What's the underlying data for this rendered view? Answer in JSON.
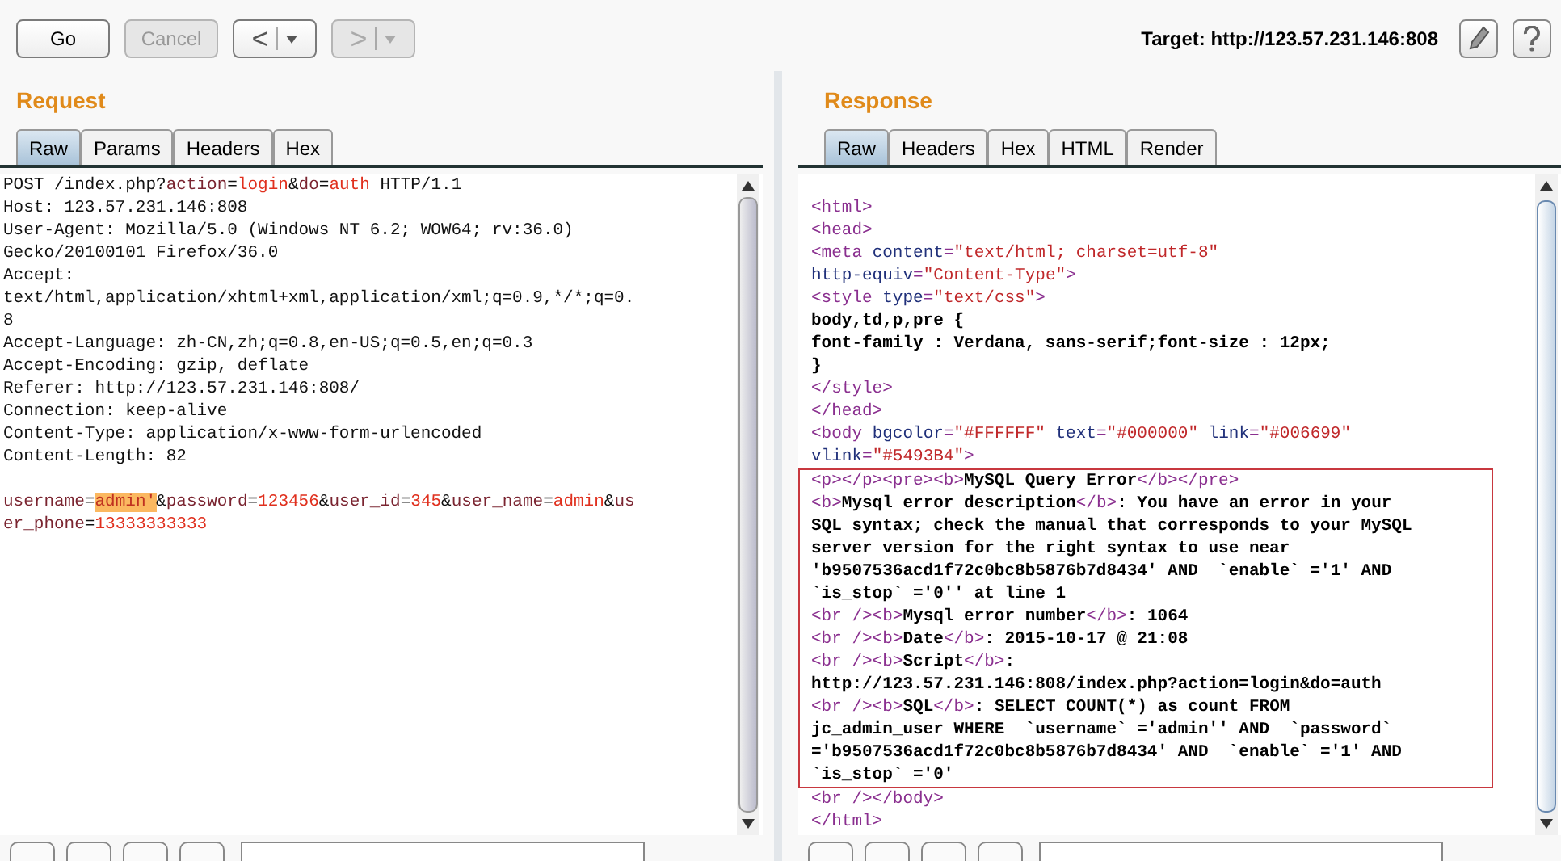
{
  "toolbar": {
    "buttons": [
      {
        "label": "Go",
        "disabled": false
      },
      {
        "label": "Cancel",
        "disabled": true
      }
    ],
    "history": [
      {
        "glyph": "<",
        "disabled": false
      },
      {
        "glyph": ">",
        "disabled": true
      }
    ],
    "target": "Target: http://123.57.231.146:808"
  },
  "request": {
    "title": "Request",
    "tabs": [
      {
        "label": "Raw",
        "selected": true
      },
      {
        "label": "Params",
        "selected": false
      },
      {
        "label": "Headers",
        "selected": false
      },
      {
        "label": "Hex",
        "selected": false
      }
    ],
    "headers": [
      [
        {
          "kind": "plain",
          "text": "POST /index.php?"
        },
        {
          "kind": "name",
          "text": "action"
        },
        {
          "kind": "plain",
          "text": "="
        },
        {
          "kind": "value",
          "text": "login"
        },
        {
          "kind": "plain",
          "text": "&"
        },
        {
          "kind": "name",
          "text": "do"
        },
        {
          "kind": "plain",
          "text": "="
        },
        {
          "kind": "value",
          "text": "auth"
        },
        {
          "kind": "plain",
          "text": " HTTP/1.1"
        }
      ],
      [
        {
          "kind": "plain",
          "text": "Host: 123.57.231.146:808"
        }
      ],
      [
        {
          "kind": "plain",
          "text": "User-Agent: Mozilla/5.0 (Windows NT 6.2; WOW64; rv:36.0)"
        }
      ],
      [
        {
          "kind": "plain",
          "text": "Gecko/20100101 Firefox/36.0"
        }
      ],
      [
        {
          "kind": "plain",
          "text": "Accept:"
        }
      ],
      [
        {
          "kind": "plain",
          "text": "text/html,application/xhtml+xml,application/xml;q=0.9,*/*;q=0."
        }
      ],
      [
        {
          "kind": "plain",
          "text": "8"
        }
      ],
      [
        {
          "kind": "plain",
          "text": "Accept-Language: zh-CN,zh;q=0.8,en-US;q=0.5,en;q=0.3"
        }
      ],
      [
        {
          "kind": "plain",
          "text": "Accept-Encoding: gzip, deflate"
        }
      ],
      [
        {
          "kind": "plain",
          "text": "Referer: http://123.57.231.146:808/"
        }
      ],
      [
        {
          "kind": "plain",
          "text": "Connection: keep-alive"
        }
      ],
      [
        {
          "kind": "plain",
          "text": "Content-Type: application/x-www-form-urlencoded"
        }
      ],
      [
        {
          "kind": "plain",
          "text": "Content-Length: 82"
        }
      ]
    ],
    "body": [
      [
        {
          "kind": "name",
          "text": "username"
        },
        {
          "kind": "plain",
          "text": "="
        },
        {
          "kind": "highlight",
          "text": "admin'"
        },
        {
          "kind": "plain",
          "text": "&"
        },
        {
          "kind": "name",
          "text": "password"
        },
        {
          "kind": "plain",
          "text": "="
        },
        {
          "kind": "value",
          "text": "123456"
        },
        {
          "kind": "plain",
          "text": "&"
        },
        {
          "kind": "name",
          "text": "user_id"
        },
        {
          "kind": "plain",
          "text": "="
        },
        {
          "kind": "value",
          "text": "345"
        },
        {
          "kind": "plain",
          "text": "&"
        },
        {
          "kind": "name",
          "text": "user_name"
        },
        {
          "kind": "plain",
          "text": "="
        },
        {
          "kind": "value",
          "text": "admin"
        },
        {
          "kind": "plain",
          "text": "&"
        },
        {
          "kind": "name",
          "text": "us"
        }
      ],
      [
        {
          "kind": "name",
          "text": "er_phone"
        },
        {
          "kind": "plain",
          "text": "="
        },
        {
          "kind": "value",
          "text": "13333333333"
        }
      ]
    ]
  },
  "response": {
    "title": "Response",
    "tabs": [
      {
        "label": "Raw",
        "selected": true
      },
      {
        "label": "Headers",
        "selected": false
      },
      {
        "label": "Hex",
        "selected": false
      },
      {
        "label": "HTML",
        "selected": false
      },
      {
        "label": "Render",
        "selected": false
      }
    ],
    "lines_before": [
      [
        {
          "kind": "tag",
          "text": "<html>"
        }
      ],
      [
        {
          "kind": "tag",
          "text": "<head>"
        }
      ],
      [
        {
          "kind": "tag",
          "text": "<meta "
        },
        {
          "kind": "attr",
          "text": "content"
        },
        {
          "kind": "tag",
          "text": "="
        },
        {
          "kind": "string",
          "text": "\"text/html; charset=utf-8\""
        }
      ],
      [
        {
          "kind": "attr",
          "text": "http-equiv"
        },
        {
          "kind": "tag",
          "text": "="
        },
        {
          "kind": "string",
          "text": "\"Content-Type\""
        },
        {
          "kind": "tag",
          "text": ">"
        }
      ],
      [
        {
          "kind": "tag",
          "text": "<style "
        },
        {
          "kind": "attr",
          "text": "type"
        },
        {
          "kind": "tag",
          "text": "="
        },
        {
          "kind": "string",
          "text": "\"text/css\""
        },
        {
          "kind": "tag",
          "text": ">"
        }
      ],
      [
        {
          "kind": "bold",
          "text": "body,td,p,pre {"
        }
      ],
      [
        {
          "kind": "bold",
          "text": "font-family : Verdana, sans-serif;font-size : 12px;"
        }
      ],
      [
        {
          "kind": "bold",
          "text": "}"
        }
      ],
      [
        {
          "kind": "tag",
          "text": "</style>"
        }
      ],
      [
        {
          "kind": "tag",
          "text": "</head>"
        }
      ],
      [
        {
          "kind": "tag",
          "text": "<body "
        },
        {
          "kind": "attr",
          "text": "bgcolor"
        },
        {
          "kind": "tag",
          "text": "="
        },
        {
          "kind": "string",
          "text": "\"#FFFFFF\" "
        },
        {
          "kind": "attr",
          "text": "text"
        },
        {
          "kind": "tag",
          "text": "="
        },
        {
          "kind": "string",
          "text": "\"#000000\" "
        },
        {
          "kind": "attr",
          "text": "link"
        },
        {
          "kind": "tag",
          "text": "="
        },
        {
          "kind": "string",
          "text": "\"#006699\""
        }
      ],
      [
        {
          "kind": "attr",
          "text": "vlink"
        },
        {
          "kind": "tag",
          "text": "="
        },
        {
          "kind": "string",
          "text": "\"#5493B4\""
        },
        {
          "kind": "tag",
          "text": ">"
        }
      ]
    ],
    "framed_lines": [
      [
        {
          "kind": "tag",
          "text": "<p></p><pre><b>"
        },
        {
          "kind": "bold",
          "text": "MySQL Query Error"
        },
        {
          "kind": "tag",
          "text": "</b></pre>"
        }
      ],
      [
        {
          "kind": "tag",
          "text": "<b>"
        },
        {
          "kind": "bold",
          "text": "Mysql error description"
        },
        {
          "kind": "tag",
          "text": "</b>"
        },
        {
          "kind": "bold",
          "text": ": You have an error in your"
        }
      ],
      [
        {
          "kind": "bold",
          "text": "SQL syntax; check the manual that corresponds to your MySQL"
        }
      ],
      [
        {
          "kind": "bold",
          "text": "server version for the right syntax to use near"
        }
      ],
      [
        {
          "kind": "bold",
          "text": "'b9507536acd1f72c0bc8b5876b7d8434' AND  `enable` ='1' AND"
        }
      ],
      [
        {
          "kind": "bold",
          "text": "`is_stop` ='0'' at line 1"
        }
      ],
      [
        {
          "kind": "tag",
          "text": "<br /><b>"
        },
        {
          "kind": "bold",
          "text": "Mysql error number"
        },
        {
          "kind": "tag",
          "text": "</b>"
        },
        {
          "kind": "bold",
          "text": ": 1064"
        }
      ],
      [
        {
          "kind": "tag",
          "text": "<br /><b>"
        },
        {
          "kind": "bold",
          "text": "Date"
        },
        {
          "kind": "tag",
          "text": "</b>"
        },
        {
          "kind": "bold",
          "text": ": 2015-10-17 @ 21:08"
        }
      ],
      [
        {
          "kind": "tag",
          "text": "<br /><b>"
        },
        {
          "kind": "bold",
          "text": "Script"
        },
        {
          "kind": "tag",
          "text": "</b>"
        },
        {
          "kind": "bold",
          "text": ":"
        }
      ],
      [
        {
          "kind": "bold",
          "text": "http://123.57.231.146:808/index.php?action=login&do=auth"
        }
      ],
      [
        {
          "kind": "tag",
          "text": "<br /><b>"
        },
        {
          "kind": "bold",
          "text": "SQL"
        },
        {
          "kind": "tag",
          "text": "</b>"
        },
        {
          "kind": "bold",
          "text": ": SELECT COUNT(*) as count FROM"
        }
      ],
      [
        {
          "kind": "bold",
          "text": "jc_admin_user WHERE  `username` ='admin'' AND  `password`"
        }
      ],
      [
        {
          "kind": "bold",
          "text": "='b9507536acd1f72c0bc8b5876b7d8434' AND  `enable` ='1' AND"
        }
      ],
      [
        {
          "kind": "bold",
          "text": "`is_stop` ='0'"
        }
      ]
    ],
    "lines_after": [
      [
        {
          "kind": "tag",
          "text": "<br /></body>"
        }
      ],
      [
        {
          "kind": "tag",
          "text": "</html>"
        }
      ]
    ]
  }
}
